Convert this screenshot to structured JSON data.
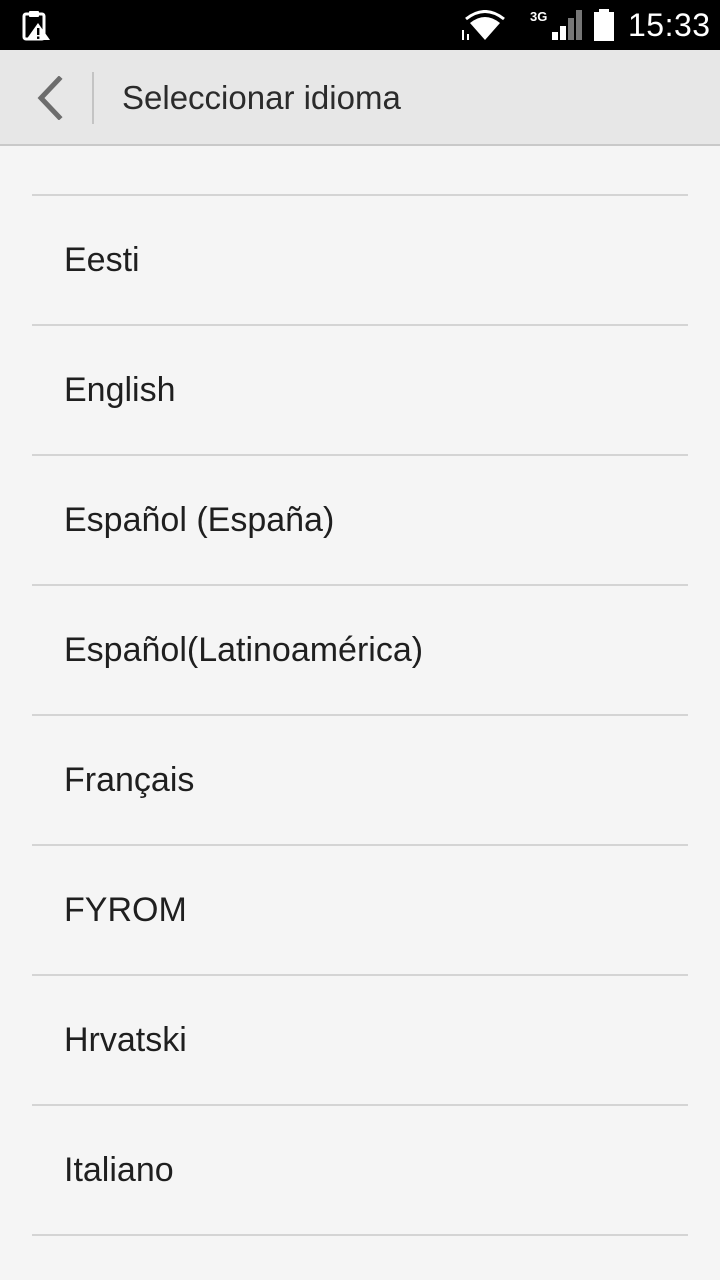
{
  "status_bar": {
    "network_type": "3G",
    "time": "15:33"
  },
  "header": {
    "title": "Seleccionar idioma",
    "back_icon": "chevron-left-icon"
  },
  "languages": [
    {
      "label": "Eesti"
    },
    {
      "label": "English"
    },
    {
      "label": "Español (España)"
    },
    {
      "label": "Español(Latinoamérica)"
    },
    {
      "label": "Français"
    },
    {
      "label": "FYROM"
    },
    {
      "label": "Hrvatski"
    },
    {
      "label": "Italiano"
    }
  ],
  "colors": {
    "status_bar_bg": "#000000",
    "action_bar_bg": "#e7e7e7",
    "page_bg": "#f5f5f5",
    "divider": "#d4d4d4",
    "text": "#1f1f1f"
  }
}
